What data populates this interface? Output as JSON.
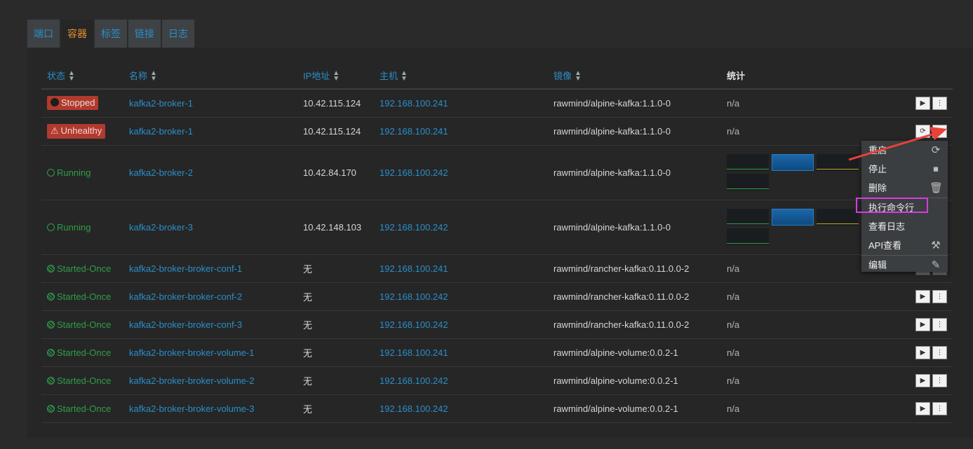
{
  "tabs": [
    "端口",
    "容器",
    "标签",
    "链接",
    "日志"
  ],
  "active_tab": "容器",
  "columns": {
    "state": "状态",
    "name": "名称",
    "ip": "IP地址",
    "host": "主机",
    "image": "镜像",
    "stats": "统计"
  },
  "rows": [
    {
      "state": "Stopped",
      "state_kind": "stopped",
      "name": "kafka2-broker-1",
      "ip": "10.42.115.124",
      "host": "192.168.100.241",
      "image": "rawmind/alpine-kafka:1.1.0-0",
      "stats": "n/a"
    },
    {
      "state": "Unhealthy",
      "state_kind": "unhealthy",
      "name": "kafka2-broker-1",
      "ip": "10.42.115.124",
      "host": "192.168.100.241",
      "image": "rawmind/alpine-kafka:1.1.0-0",
      "stats": "n/a"
    },
    {
      "state": "Running",
      "state_kind": "running",
      "name": "kafka2-broker-2",
      "ip": "10.42.84.170",
      "host": "192.168.100.242",
      "image": "rawmind/alpine-kafka:1.1.0-0",
      "stats": ""
    },
    {
      "state": "Running",
      "state_kind": "running",
      "name": "kafka2-broker-3",
      "ip": "10.42.148.103",
      "host": "192.168.100.242",
      "image": "rawmind/alpine-kafka:1.1.0-0",
      "stats": ""
    },
    {
      "state": "Started-Once",
      "state_kind": "once",
      "name": "kafka2-broker-broker-conf-1",
      "ip": "无",
      "host": "192.168.100.241",
      "image": "rawmind/rancher-kafka:0.11.0.0-2",
      "stats": "n/a"
    },
    {
      "state": "Started-Once",
      "state_kind": "once",
      "name": "kafka2-broker-broker-conf-2",
      "ip": "无",
      "host": "192.168.100.242",
      "image": "rawmind/rancher-kafka:0.11.0.0-2",
      "stats": "n/a"
    },
    {
      "state": "Started-Once",
      "state_kind": "once",
      "name": "kafka2-broker-broker-conf-3",
      "ip": "无",
      "host": "192.168.100.242",
      "image": "rawmind/rancher-kafka:0.11.0.0-2",
      "stats": "n/a"
    },
    {
      "state": "Started-Once",
      "state_kind": "once",
      "name": "kafka2-broker-broker-volume-1",
      "ip": "无",
      "host": "192.168.100.241",
      "image": "rawmind/alpine-volume:0.0.2-1",
      "stats": "n/a"
    },
    {
      "state": "Started-Once",
      "state_kind": "once",
      "name": "kafka2-broker-broker-volume-2",
      "ip": "无",
      "host": "192.168.100.242",
      "image": "rawmind/alpine-volume:0.0.2-1",
      "stats": "n/a"
    },
    {
      "state": "Started-Once",
      "state_kind": "once",
      "name": "kafka2-broker-broker-volume-3",
      "ip": "无",
      "host": "192.168.100.242",
      "image": "rawmind/alpine-volume:0.0.2-1",
      "stats": "n/a"
    }
  ],
  "context_menu": [
    {
      "label": "重启",
      "icon": "restart-icon"
    },
    {
      "label": "停止",
      "icon": "stop-icon"
    },
    {
      "label": "删除",
      "icon": "trash-icon"
    },
    {
      "label": "执行命令行",
      "icon": ""
    },
    {
      "label": "查看日志",
      "icon": ""
    },
    {
      "label": "API查看",
      "icon": "api-icon"
    },
    {
      "label": "编辑",
      "icon": "pencil-icon"
    }
  ],
  "colors": {
    "link": "#2a8fc9",
    "active_tab": "#e8902f",
    "running": "#2f9e48",
    "error_badge": "#b13a2e",
    "highlight_box": "#d63ce0",
    "annotation_arrow": "#e8413a"
  }
}
